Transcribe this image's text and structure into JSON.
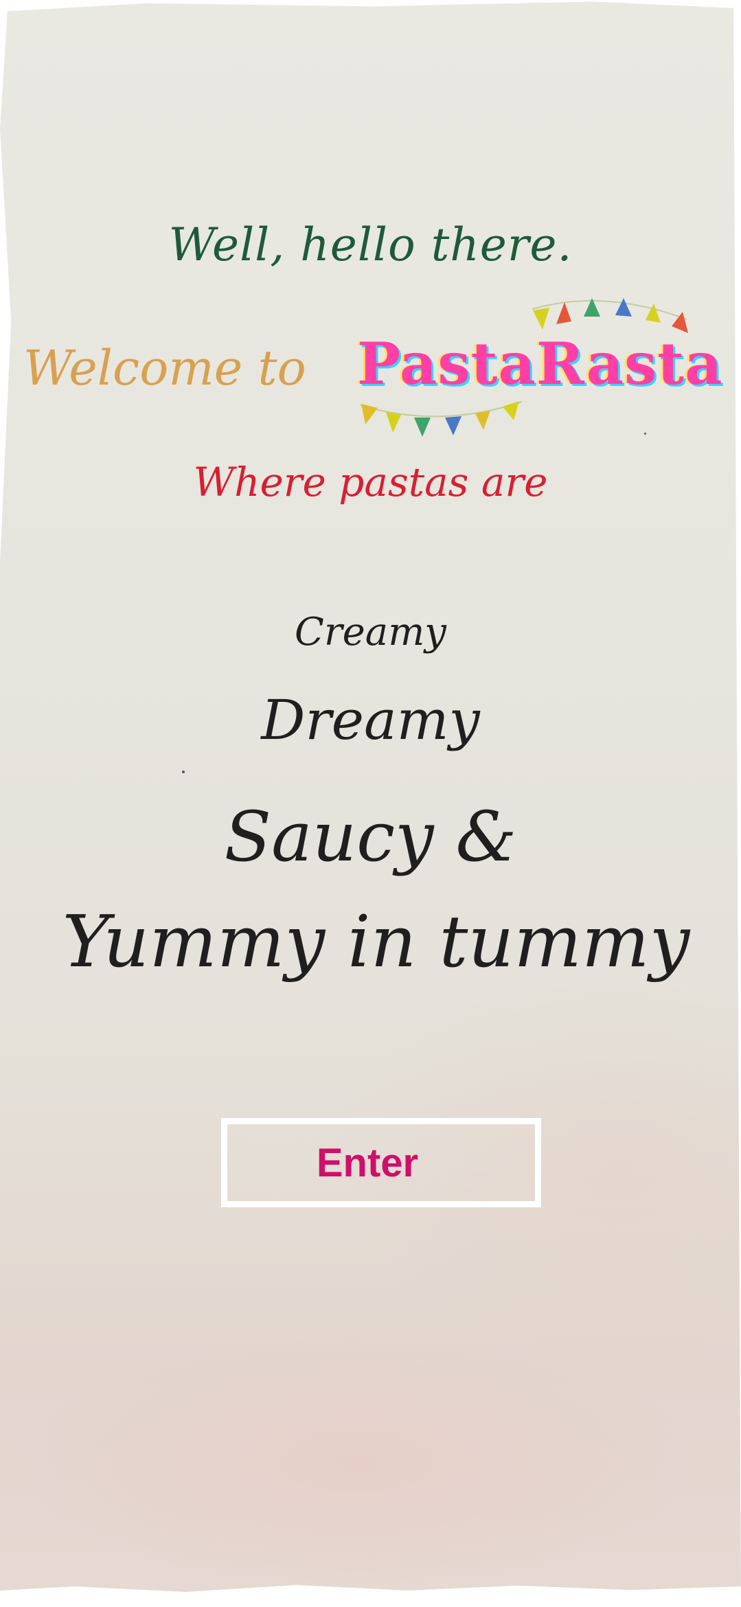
{
  "greeting": "Well, hello there.",
  "welcome": "Welcome to",
  "brand": "PastaRasta",
  "tagline": "Where pastas are",
  "descriptors": [
    "Creamy",
    "Dreamy",
    "Saucy &",
    "Yummy in tummy"
  ],
  "enter_button": "Enter",
  "colors": {
    "greeting": "#1e5a3a",
    "welcome": "#d9a050",
    "tagline": "#d81f31",
    "enter": "#cf0f6a"
  }
}
